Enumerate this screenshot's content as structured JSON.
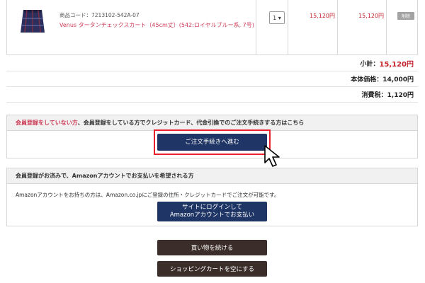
{
  "cart": {
    "item": {
      "product_code": "商品コード：7213102-542A-07",
      "name": "Venus タータンチェックスカート（45cm丈）(542:ロイヤルブルー系, 7号)",
      "quantity": "1 ▾",
      "unit_price": "15,120円",
      "subtotal_price": "15,120円",
      "delete_label": "削除",
      "colors": {
        "name": "#d03b57",
        "price": "#c4222b"
      }
    }
  },
  "totals": {
    "subtotal_label": "小計：",
    "subtotal_value": "15,120円",
    "base_label": "本体価格：14,000円",
    "tax_label": "消費税：1,120円"
  },
  "checkout_section": {
    "heading_pink": "会員登録をしていない方",
    "heading_rest": "、会員登録をしている方でクレジットカード、代金引換でのご注文手続きする方はこちら",
    "button_label": "ご注文手続きへ進む"
  },
  "amazon_section": {
    "heading": "会員登録がお済みで、Amazonアカウントでお支払いを希望される方",
    "description": "Amazonアカウントをお持ちの方は、Amazon.co.jpにご登録の住所・クレジットカードでご注文が可能です。",
    "button_line1": "サイトにログインして",
    "button_line2": "Amazonアカウントでお支払い"
  },
  "footer_buttons": {
    "continue_shopping": "買い物を続ける",
    "empty_cart": "ショッピングカートを空にする"
  }
}
